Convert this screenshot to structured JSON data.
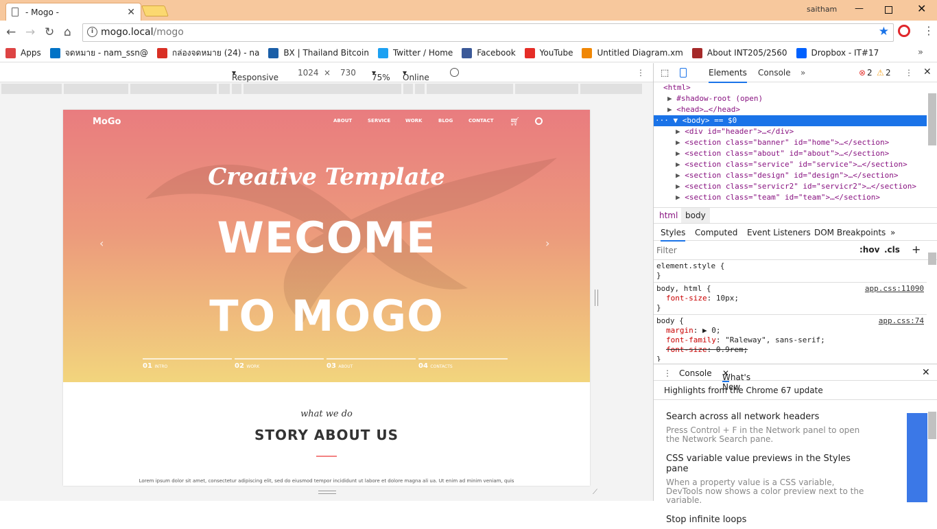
{
  "browser": {
    "tab_title": "- Mogo -",
    "user": "saitham",
    "url_host": "mogo.local",
    "url_path": "/mogo"
  },
  "bookmarks": [
    {
      "label": "Apps",
      "icon": "apps-grid-icon",
      "color": "#d44"
    },
    {
      "label": "จดหมาย - nam_ssn@",
      "icon": "outlook-icon",
      "color": "#0072c6"
    },
    {
      "label": "กล่องจดหมาย (24) - na",
      "icon": "gmail-icon",
      "color": "#d93025"
    },
    {
      "label": "BX | Thailand Bitcoin",
      "icon": "bx-icon",
      "color": "#1b5fa8"
    },
    {
      "label": "Twitter / Home",
      "icon": "twitter-icon",
      "color": "#1da1f2"
    },
    {
      "label": "Facebook",
      "icon": "facebook-icon",
      "color": "#3b5998"
    },
    {
      "label": "YouTube",
      "icon": "youtube-icon",
      "color": "#e52d27"
    },
    {
      "label": "Untitled Diagram.xm",
      "icon": "drawio-icon",
      "color": "#f08705"
    },
    {
      "label": "About INT205/2560",
      "icon": "about-icon",
      "color": "#a52a2a"
    },
    {
      "label": "Dropbox - IT#17",
      "icon": "dropbox-icon",
      "color": "#0061fe"
    }
  ],
  "device_toolbar": {
    "mode": "Responsive",
    "width": "1024",
    "height": "730",
    "zoom": "75%",
    "throttle": "Online"
  },
  "site": {
    "logo": "MoGo",
    "nav": [
      "ABOUT",
      "SERVICE",
      "WORK",
      "BLOG",
      "CONTACT"
    ],
    "script_title": "Creative Template",
    "headline1": "WECOME",
    "headline2": "TO MOGO",
    "slides": [
      {
        "num": "01",
        "label": "INTRO"
      },
      {
        "num": "02",
        "label": "WORK"
      },
      {
        "num": "03",
        "label": "ABOUT"
      },
      {
        "num": "04",
        "label": "CONTACTS"
      }
    ],
    "what_we_do": "what we do",
    "story_title": "STORY ABOUT US",
    "lorem": "Lorem ipsum dolor sit amet, consectetur adipiscing elit, sed do eiusmod tempor incididunt ut labore et dolore magna ali ua. Ut enim ad minim veniam, quis"
  },
  "devtools": {
    "tabs": [
      "Elements",
      "Console"
    ],
    "errors": "2",
    "warnings": "2",
    "dom": [
      {
        "text": "<html>"
      },
      {
        "text": "#shadow-root (open)"
      },
      {
        "text": "<head>…</head>"
      },
      {
        "text": "<body> == $0"
      },
      {
        "text": "<div id=\"header\">…</div>"
      },
      {
        "text": "<section class=\"banner\" id=\"home\">…</section>"
      },
      {
        "text": "<section class=\"about\" id=\"about\">…</section>"
      },
      {
        "text": "<section class=\"service\" id=\"service\">…</section>"
      },
      {
        "text": "<section class=\"design\" id=\"design\">…</section>"
      },
      {
        "text": "<section class=\"servicr2\" id=\"servicr2\">…</section>"
      },
      {
        "text": "<section class=\"team\" id=\"team\">…</section>"
      }
    ],
    "breadcrumbs": [
      "html",
      "body"
    ],
    "style_tabs": [
      "Styles",
      "Computed",
      "Event Listeners",
      "DOM Breakpoints"
    ],
    "filter_placeholder": "Filter",
    "hov": ":hov",
    "cls": ".cls",
    "rules": [
      {
        "selector": "element.style {",
        "source": "",
        "props": []
      },
      {
        "selector": "body, html {",
        "source": "app.css:11090",
        "props": [
          {
            "name": "font-size",
            "value": "10px;"
          }
        ]
      },
      {
        "selector": "body {",
        "source": "app.css:74",
        "props": [
          {
            "name": "margin",
            "value": "▶ 0;"
          },
          {
            "name": "font-family",
            "value": "\"Raleway\", sans-serif;"
          },
          {
            "name": "font-size",
            "value": "0.9rem;"
          }
        ]
      }
    ],
    "drawer_tabs": [
      "Console",
      "What's New"
    ],
    "highlights": "Highlights from the Chrome 67 update",
    "news": [
      {
        "title": "Search across all network headers",
        "body": "Press Control + F in the Network panel to open the Network Search pane."
      },
      {
        "title": "CSS variable value previews in the Styles pane",
        "body": "When a property value is a CSS variable, DevTools now shows a color preview next to the variable."
      },
      {
        "title": "Stop infinite loops",
        "body": ""
      }
    ]
  }
}
